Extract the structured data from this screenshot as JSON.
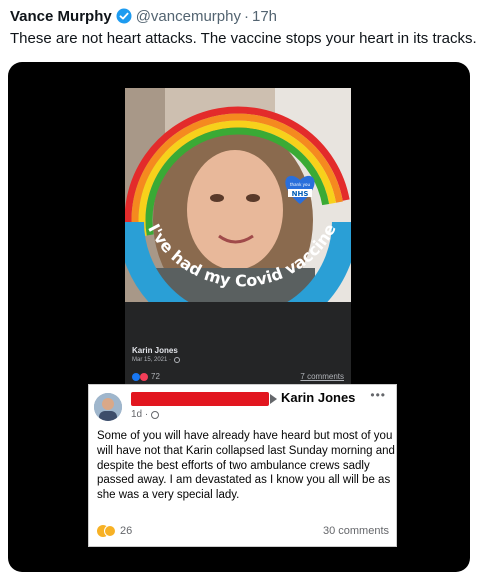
{
  "tweet": {
    "author_name": "Vance Murphy",
    "handle": "@vancemurphy",
    "separator": "·",
    "time": "17h",
    "text": "These are not heart attacks. The vaccine stops your heart in its tracks."
  },
  "embedded_post": {
    "badge_text": "I've had my Covid vaccine",
    "heart_small_text": "thank you",
    "heart_logo": "NHS",
    "author": "Karin Jones",
    "date": "Mar 15, 2021 ·",
    "reaction_count": "72",
    "comments": "7 comments"
  },
  "overlay_post": {
    "name": "Karin Jones",
    "more": "•••",
    "time": "1d ·",
    "body": "Some of you will have already have heard but most of you will have not that Karin collapsed last Sunday morning and despite the best efforts of two ambulance crews sadly passed away. I am devastated as I know you all will be as she was a very special lady.",
    "reaction_count": "26",
    "comments": "30 comments"
  },
  "colors": {
    "verified": "#1d9bf0",
    "redaction": "#e2161f",
    "nhs_blue": "#2a9fd6"
  }
}
